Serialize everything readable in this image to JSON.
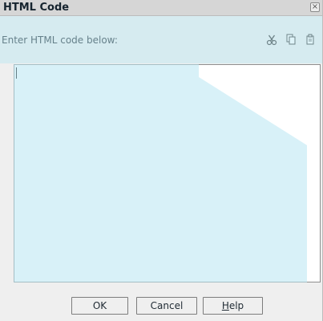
{
  "dialog": {
    "title": "HTML Code",
    "close_label": "×"
  },
  "prompt": {
    "label": "Enter HTML code below:"
  },
  "toolbar": {
    "icons": [
      "cut-icon",
      "copy-icon",
      "paste-icon"
    ]
  },
  "editor": {
    "value": ""
  },
  "buttons": {
    "ok_label": "OK",
    "cancel_label": "Cancel",
    "help_label_first": "H",
    "help_label_rest": "elp"
  },
  "colors": {
    "watermark": "#b8e6f2",
    "title_bar": "#d6d6d6",
    "dialog_bg": "#efefef"
  }
}
